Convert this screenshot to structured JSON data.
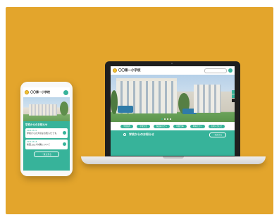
{
  "colors": {
    "background": "#e3a52c",
    "accent": "#37b39a",
    "device_dark": "#1f1f1f"
  },
  "phone": {
    "site_title": "〇〇第一小学校",
    "news_title": "学校からのお知らせ",
    "news": [
      {
        "date": "2022.03.22",
        "text": "学校からの大切なお知らせです。"
      },
      {
        "date": "2022.03.18",
        "text": "新型コロナ対策について"
      }
    ],
    "list_button": "一覧を見る"
  },
  "laptop": {
    "site_title": "〇〇第一小学校",
    "nav": [
      "学校案内",
      "学校生活",
      "保護者の方へ",
      "年間行事",
      "地域の方へ",
      "お問い合わせ"
    ],
    "news_title": "学校からのお知らせ",
    "news_button": "一覧を見る"
  }
}
